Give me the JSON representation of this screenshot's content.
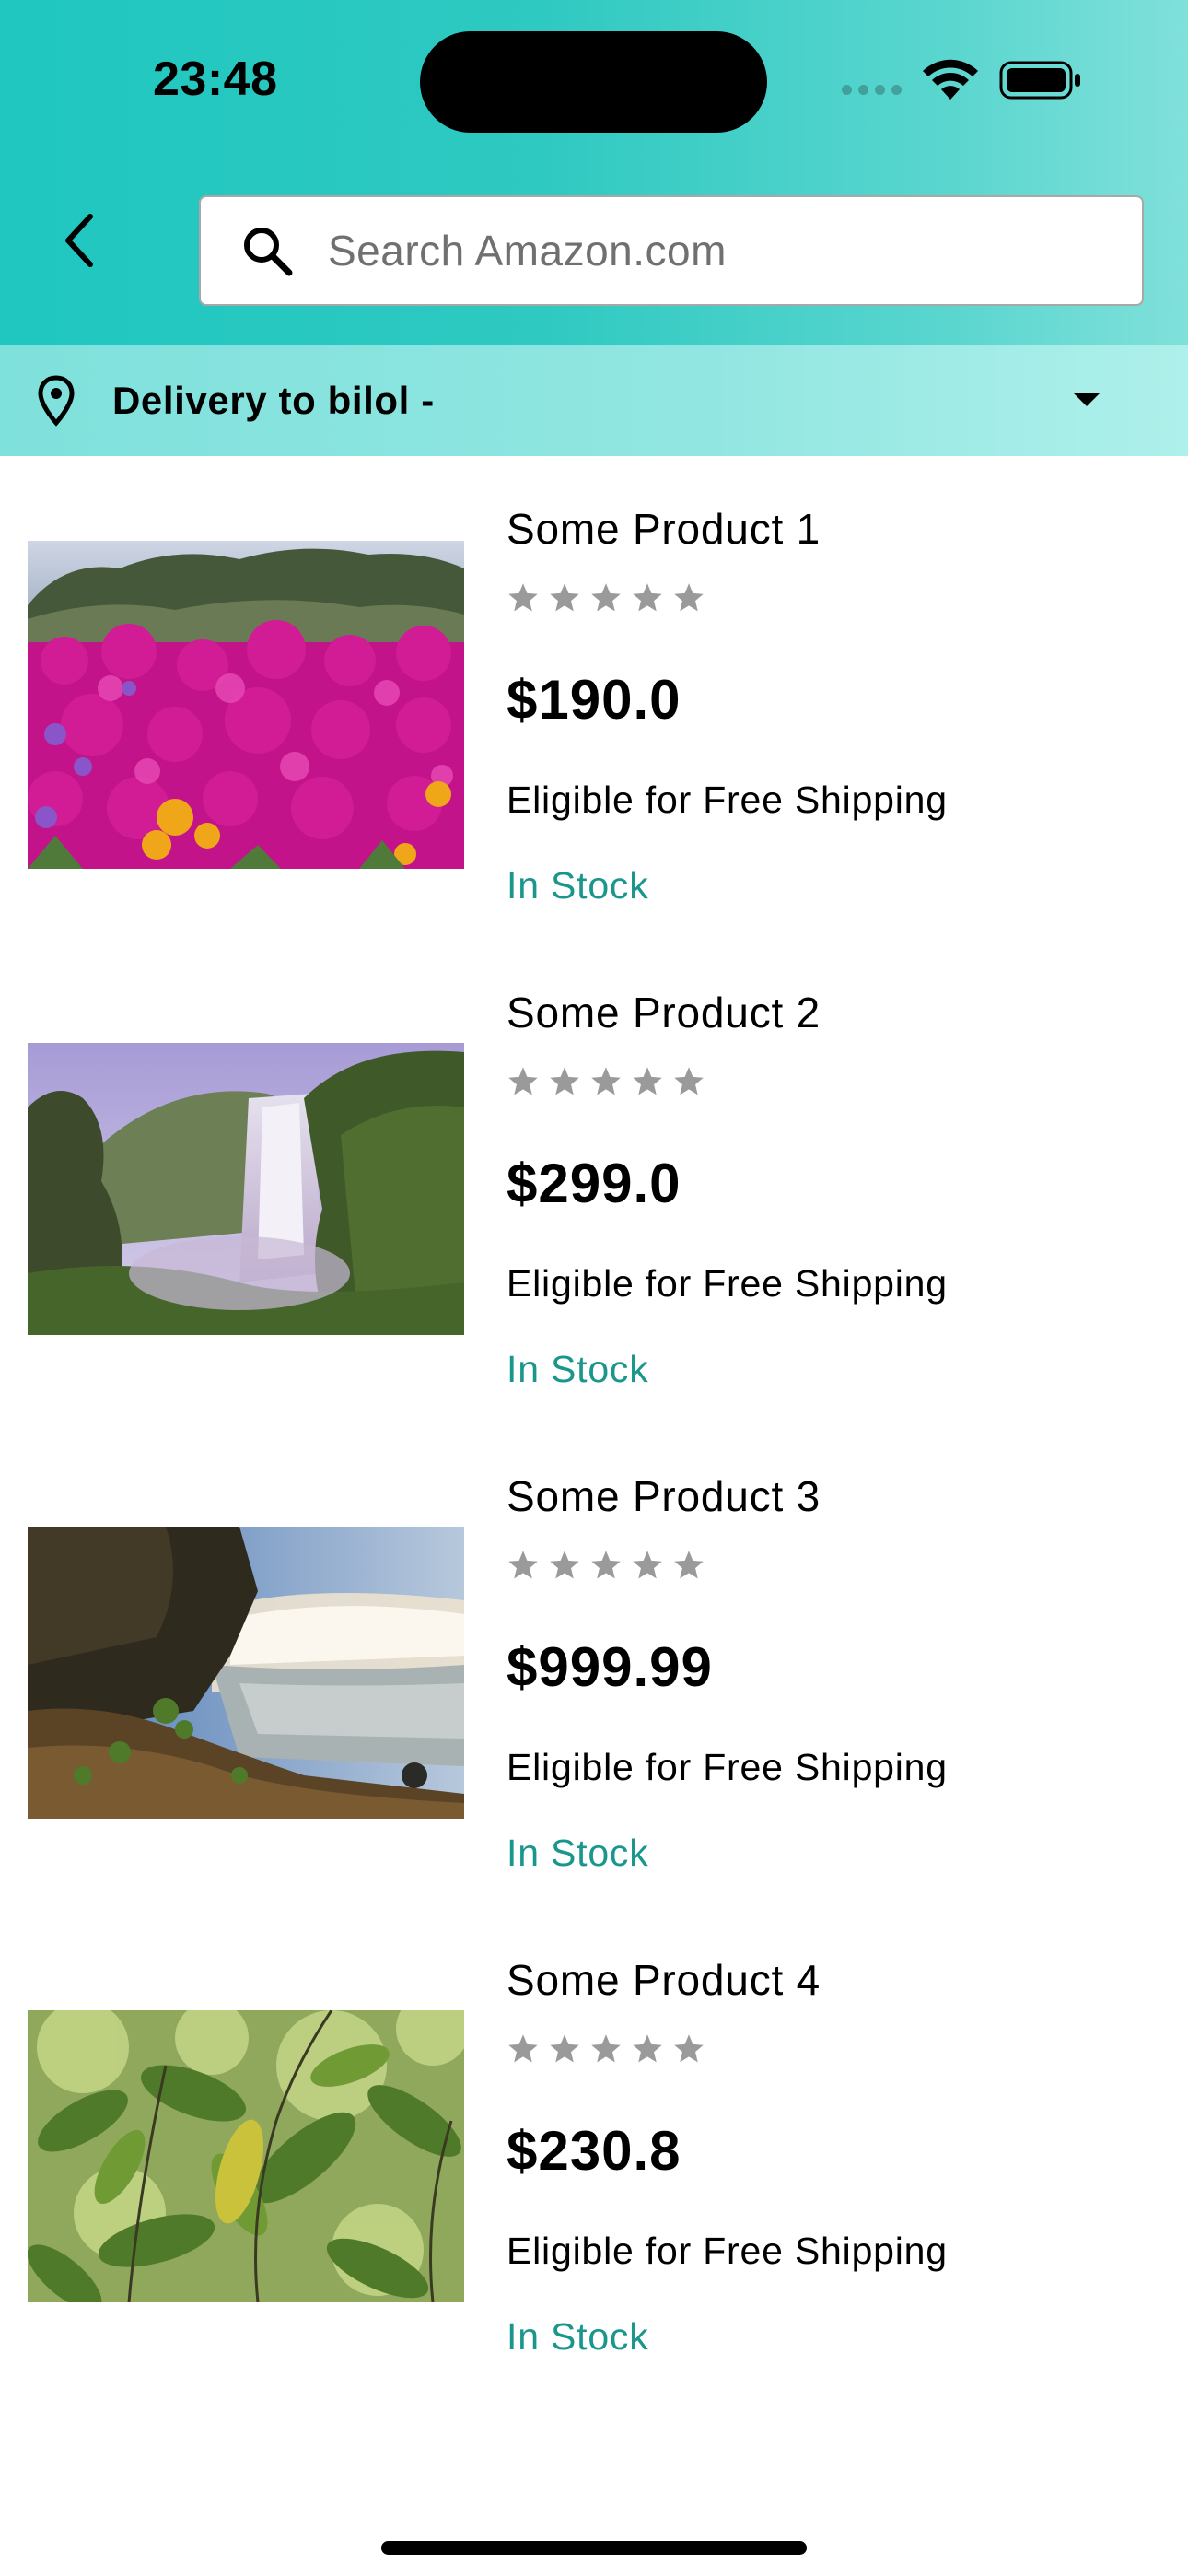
{
  "status_bar": {
    "time": "23:48"
  },
  "header": {
    "back_icon": "chevron-left-icon",
    "search": {
      "icon": "search-icon",
      "placeholder": "Search Amazon.com"
    },
    "gradient_colors": [
      "#1fc7c0",
      "#80e0da"
    ]
  },
  "delivery": {
    "icon": "location-pin-icon",
    "text": "Delivery to bilol -",
    "dropdown_icon": "caret-down-icon"
  },
  "products": [
    {
      "name": "Some Product 1",
      "rating": 0,
      "price": "$190.0",
      "shipping": "Eligible for Free Shipping",
      "stock": "In Stock",
      "image": "pink flowers field"
    },
    {
      "name": "Some Product 2",
      "rating": 0,
      "price": "$299.0",
      "shipping": "Eligible for Free Shipping",
      "stock": "In Stock",
      "image": "waterfall in green canyon"
    },
    {
      "name": "Some Product 3",
      "rating": 0,
      "price": "$999.99",
      "shipping": "Eligible for Free Shipping",
      "stock": "In Stock",
      "image": "misty waterfall and river"
    },
    {
      "name": "Some Product 4",
      "rating": 0,
      "price": "$230.8",
      "shipping": "Eligible for Free Shipping",
      "stock": "In Stock",
      "image": "green leaves close-up"
    }
  ],
  "colors": {
    "accent_teal": "#1fc7c0",
    "stock_green": "#1a968d",
    "star_gray": "#9a9a9a"
  }
}
